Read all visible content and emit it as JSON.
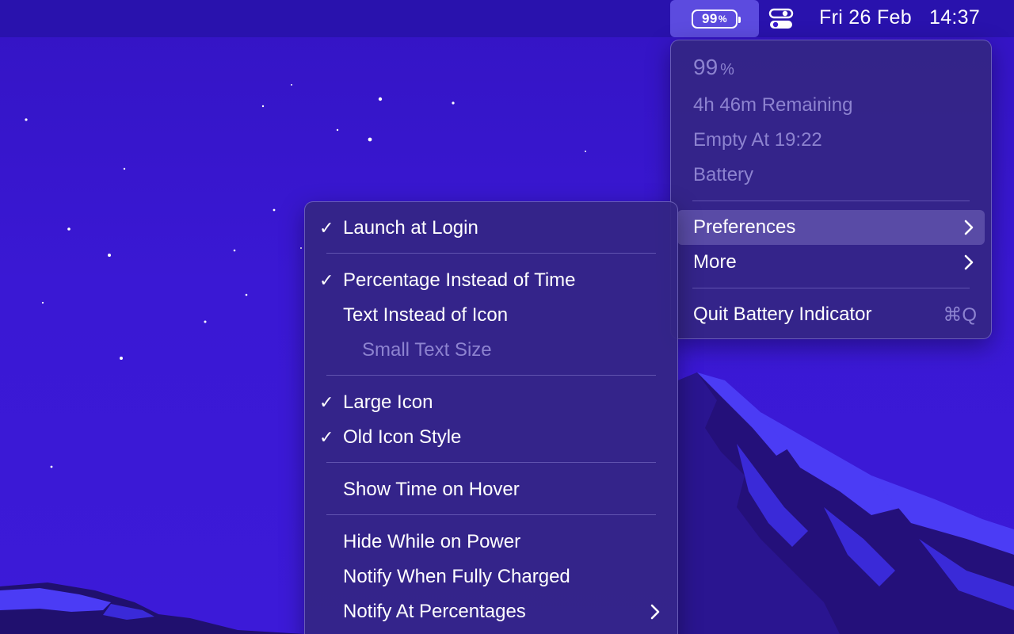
{
  "menubar": {
    "battery_percent": "99",
    "battery_percent_sign": "%",
    "date": "Fri 26 Feb",
    "time": "14:37",
    "icons": [
      "battery-icon",
      "control-center-icon"
    ]
  },
  "main_menu": {
    "percent_value": "99",
    "percent_sign": "%",
    "remaining": "4h 46m Remaining",
    "empty_at": "Empty At 19:22",
    "source": "Battery",
    "preferences": "Preferences",
    "more": "More",
    "quit": "Quit Battery Indicator",
    "quit_shortcut": "⌘Q"
  },
  "prefs_menu": {
    "items": [
      {
        "label": "Launch at Login",
        "checked": true
      },
      {
        "label": "Percentage Instead of Time",
        "checked": true
      },
      {
        "label": "Text Instead of Icon",
        "checked": false
      },
      {
        "label": "Small Text Size",
        "checked": false,
        "disabled": true
      },
      {
        "label": "Large Icon",
        "checked": true
      },
      {
        "label": "Old Icon Style",
        "checked": true
      },
      {
        "label": "Show Time on Hover",
        "checked": false
      },
      {
        "label": "Hide While on Power",
        "checked": false
      },
      {
        "label": "Notify When Fully Charged",
        "checked": false
      },
      {
        "label": "Notify At Percentages",
        "checked": false,
        "submenu": true
      }
    ],
    "check_glyph": "✓"
  },
  "colors": {
    "wallpaper": "#3a18d4",
    "menu_bg": "#342684",
    "disabled_text": "#8d83d0",
    "mountain_bright": "#4b3cf5",
    "mountain_dark": "#24107a"
  }
}
